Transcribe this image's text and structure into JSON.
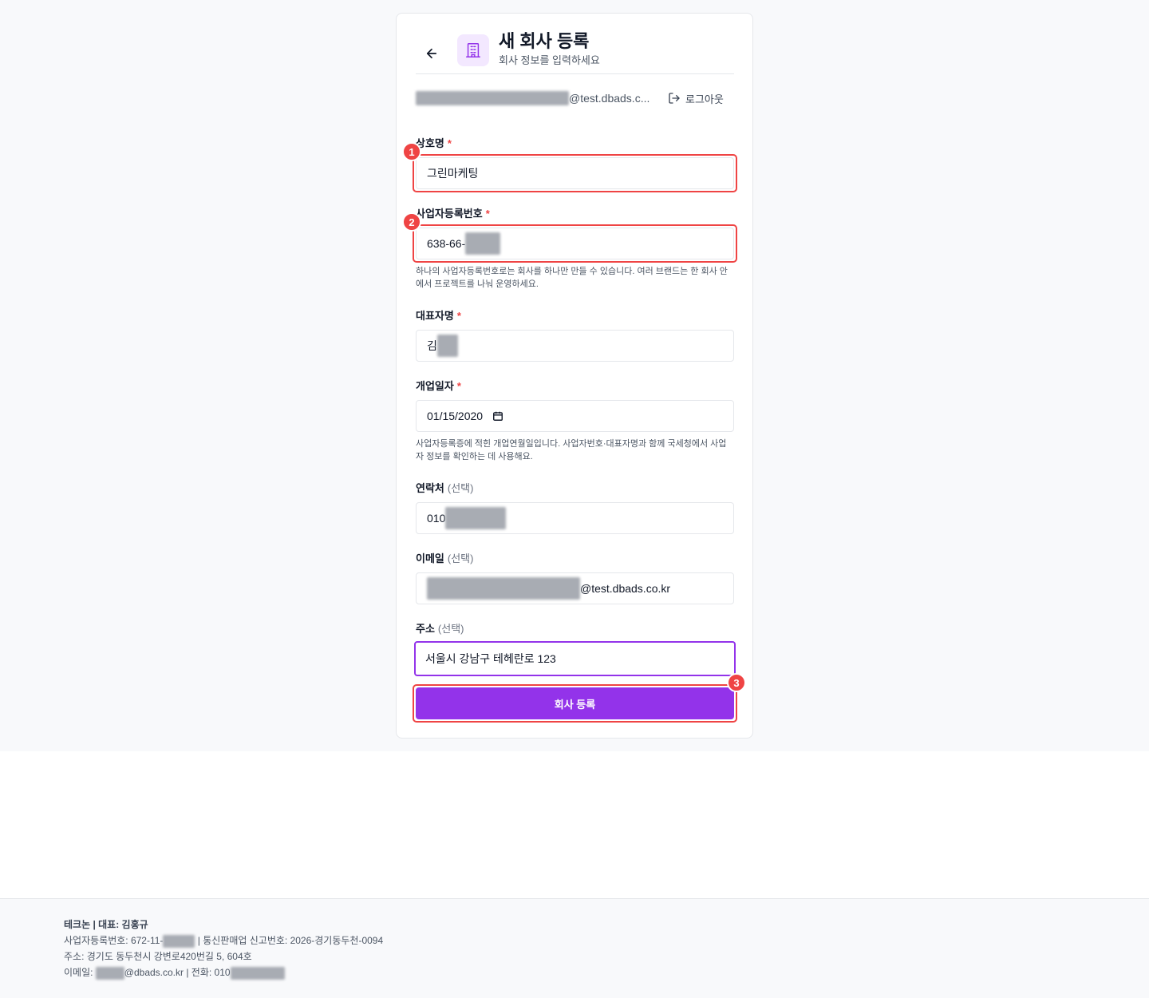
{
  "header": {
    "title": "새 회사 등록",
    "subtitle": "회사 정보를 입력하세요"
  },
  "user": {
    "email_suffix": "@test.dbads.c...",
    "logout_label": "로그아웃"
  },
  "form": {
    "company_name": {
      "label": "상호명",
      "required": "*",
      "value": "그린마케팅"
    },
    "biz_number": {
      "label": "사업자등록번호",
      "required": "*",
      "value_prefix": "638-66-",
      "hint": "하나의 사업자등록번호로는 회사를 하나만 만들 수 있습니다. 여러 브랜드는 한 회사 안에서 프로젝트를 나눠 운영하세요."
    },
    "ceo_name": {
      "label": "대표자명",
      "required": "*",
      "value_prefix": "김"
    },
    "open_date": {
      "label": "개업일자",
      "required": "*",
      "value": "01/15/2020",
      "hint": "사업자등록증에 적힌 개업연월일입니다. 사업자번호·대표자명과 함께 국세청에서 사업자 정보를 확인하는 데 사용해요."
    },
    "phone": {
      "label": "연락처",
      "optional": "(선택)",
      "value_prefix": "010"
    },
    "email": {
      "label": "이메일",
      "optional": "(선택)",
      "value_suffix": "@test.dbads.co.kr"
    },
    "address": {
      "label": "주소",
      "optional": "(선택)",
      "value": "서울시 강남구 테헤란로 123"
    },
    "submit_label": "회사 등록"
  },
  "annotations": {
    "badge1": "1",
    "badge2": "2",
    "badge3": "3"
  },
  "footer": {
    "company_line": "테크논 | 대표: 김홍규",
    "biz_prefix": "사업자등록번호: 672-11-",
    "biz_suffix": " | 통신판매업 신고번호: 2026-경기동두천-0094",
    "address_line": "주소: 경기도 동두천시 강변로420번길 5, 604호",
    "email_prefix": "이메일: ",
    "email_suffix": "@dbads.co.kr | 전화: 010"
  },
  "colors": {
    "accent": "#9333ea",
    "highlight": "#ef4444",
    "required": "#ef4444"
  },
  "icons": [
    "arrow-left-icon",
    "building-icon",
    "logout-icon",
    "calendar-icon"
  ]
}
